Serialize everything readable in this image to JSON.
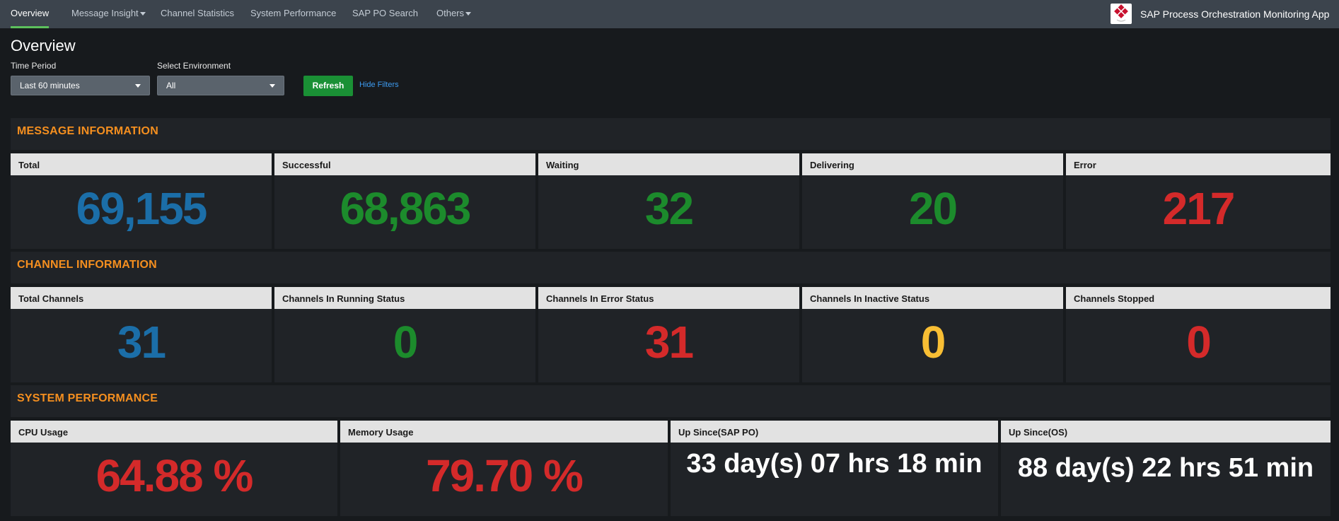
{
  "nav": {
    "items": [
      {
        "label": "Overview",
        "dropdown": false,
        "active": true
      },
      {
        "label": "Message Insight",
        "dropdown": true,
        "active": false
      },
      {
        "label": "Channel Statistics",
        "dropdown": false,
        "active": false
      },
      {
        "label": "System Performance",
        "dropdown": false,
        "active": false
      },
      {
        "label": "SAP PO Search",
        "dropdown": false,
        "active": false
      },
      {
        "label": "Others",
        "dropdown": true,
        "active": false
      }
    ],
    "app_title": "SAP Process Orchestration Monitoring App",
    "logo_icon": "app-logo-icon"
  },
  "page": {
    "title": "Overview"
  },
  "filters": {
    "time_period": {
      "label": "Time Period",
      "value": "Last 60 minutes"
    },
    "environment": {
      "label": "Select Environment",
      "value": "All"
    },
    "refresh_label": "Refresh",
    "hide_filters_label": "Hide Filters"
  },
  "sections": {
    "message": {
      "title": "MESSAGE INFORMATION",
      "panels": [
        {
          "label": "Total",
          "value": "69,155"
        },
        {
          "label": "Successful",
          "value": "68,863"
        },
        {
          "label": "Waiting",
          "value": "32"
        },
        {
          "label": "Delivering",
          "value": "20"
        },
        {
          "label": "Error",
          "value": "217"
        }
      ]
    },
    "channel": {
      "title": "CHANNEL INFORMATION",
      "panels": [
        {
          "label": "Total Channels",
          "value": "31"
        },
        {
          "label": "Channels In Running Status",
          "value": "0"
        },
        {
          "label": "Channels In Error Status",
          "value": "31"
        },
        {
          "label": "Channels In Inactive Status",
          "value": "0"
        },
        {
          "label": "Channels Stopped",
          "value": "0"
        }
      ]
    },
    "system": {
      "title": "SYSTEM PERFORMANCE",
      "panels": [
        {
          "label": "CPU Usage",
          "value": "64.88 %"
        },
        {
          "label": "Memory Usage",
          "value": "79.70 %"
        },
        {
          "label": "Up Since(SAP PO)",
          "value": "33 day(s) 07 hrs 18 min"
        },
        {
          "label": "Up Since(OS)",
          "value": "88 day(s) 22 hrs 51 min"
        }
      ]
    }
  },
  "colors": {
    "blue": "#1b6ea8",
    "green": "#1c8b2c",
    "red": "#d42a2a",
    "yellow": "#f8be34",
    "section_title": "#f58f1f",
    "nav_bg": "#3c444d",
    "refresh_bg": "#1a9035"
  }
}
